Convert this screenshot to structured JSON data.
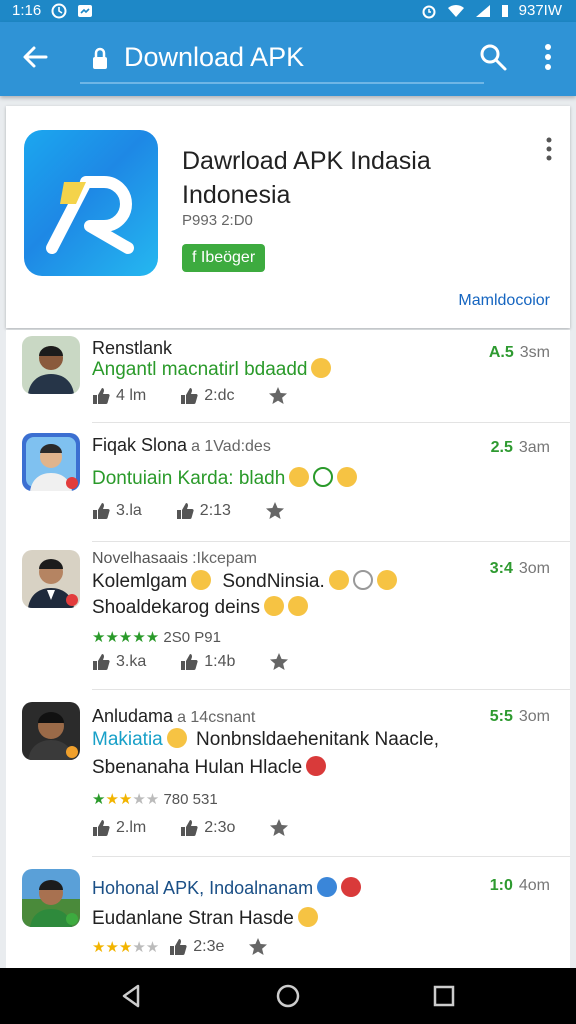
{
  "status_bar": {
    "time": "1:16",
    "right_text": "937IW"
  },
  "app_bar": {
    "title": "Download APK"
  },
  "app_card": {
    "title_line1": "Dawrload APK Indasia",
    "title_line2": "Indonesia",
    "meta": "P993 2:D0",
    "badge": "f Ibeöger",
    "link": "Mamldocoior"
  },
  "reviews": [
    {
      "name": "Renstlank",
      "sub": "",
      "rating": "A.5",
      "time": "3sm",
      "lines": [
        "Angantl macnatirl bdaadd"
      ],
      "line_green": true,
      "likes": "4 lm",
      "shares": "2:dc"
    },
    {
      "name": "Fiqak Slona",
      "sub": "a 1Vad:des",
      "rating": "2.5",
      "time": "3am",
      "lines": [
        "Dontuiain Karda: bladh"
      ],
      "line_green": true,
      "likes": "3.la",
      "shares": "2:13"
    },
    {
      "name": "Novelhasaais",
      "sub": ":Ikcepam",
      "rating": "3:4",
      "time": "3om",
      "lines": [
        "Kolemlgam",
        "SondNinsia.",
        "Shoaldekarog deins"
      ],
      "stars_text": "2S0 P91",
      "likes": "3.ka",
      "shares": "1:4b"
    },
    {
      "name": "Anludama",
      "sub": "a 14csnant",
      "rating": "5:5",
      "time": "3om",
      "lines": [
        "Makiatia",
        "Nonbnsldaehenitank Naacle,",
        "Sbenanaha Hulan Hlacle"
      ],
      "stars_text": "780 531",
      "likes": "2.lm",
      "shares": "2:3o"
    },
    {
      "name": "Hohonal APK, Indoalnanam",
      "sub": "",
      "rating": "1:0",
      "time": "4om",
      "lines": [
        "Eudanlane Stran Hasde"
      ],
      "shares": "2:3e"
    }
  ],
  "colors": {
    "appbar": "#2f93d6",
    "status": "#1e88c7",
    "green": "#2e9a30",
    "link": "#1565c0"
  },
  "icons": [
    "back-arrow-icon",
    "lock-icon",
    "search-icon",
    "more-vert-icon",
    "thumb-up-icon",
    "share-icon",
    "star-icon"
  ]
}
